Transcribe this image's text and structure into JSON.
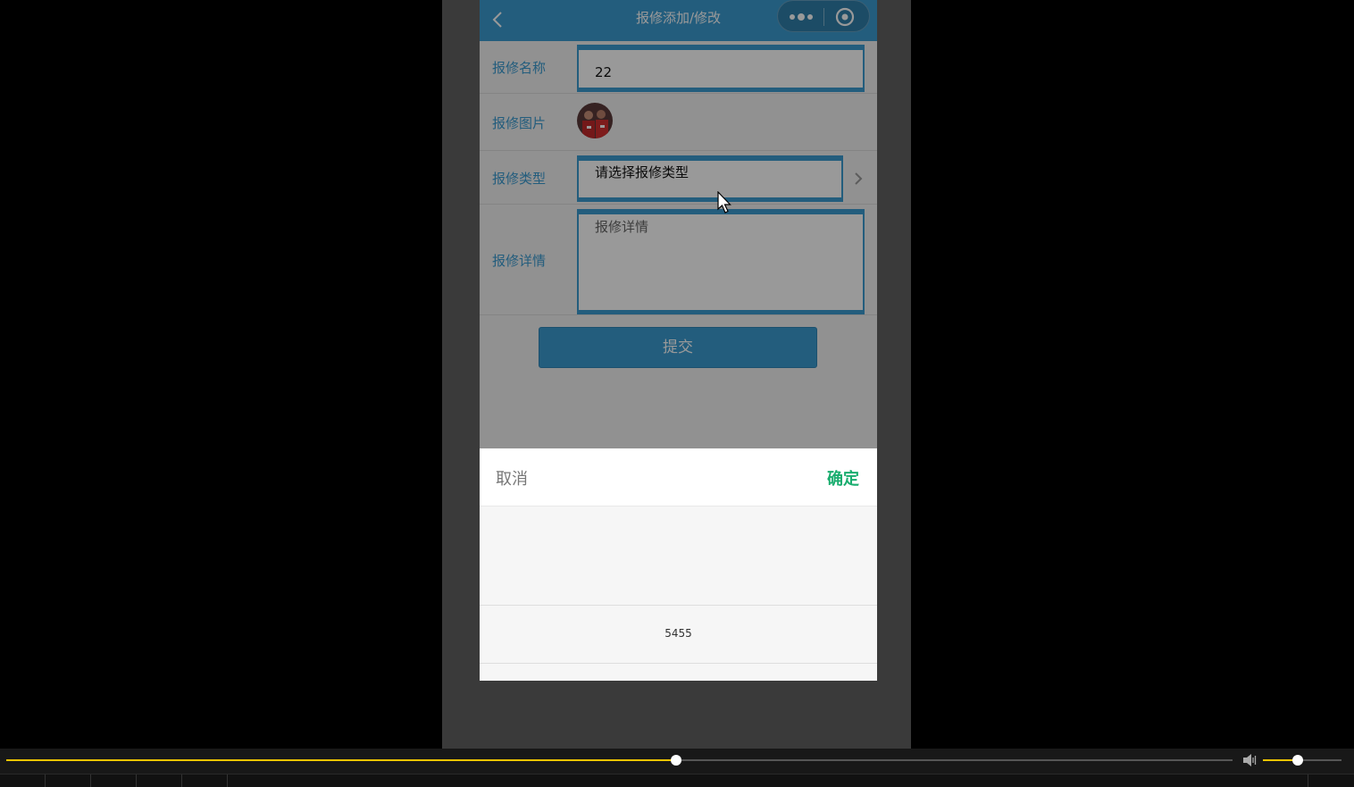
{
  "nav": {
    "title": "报修添加/修改",
    "back_icon": "chevron-left-icon",
    "more_icon": "more-dots-icon",
    "close_icon": "target-circle-icon"
  },
  "form": {
    "name": {
      "label": "报修名称",
      "value": "22"
    },
    "image": {
      "label": "报修图片"
    },
    "type": {
      "label": "报修类型",
      "value": "请选择报修类型"
    },
    "detail": {
      "label": "报修详情",
      "placeholder": "报修详情"
    },
    "submit_label": "提交"
  },
  "picker": {
    "cancel_label": "取消",
    "confirm_label": "确定",
    "selected_option": "5455"
  },
  "player": {
    "progress_fraction": 0.546,
    "volume_fraction": 0.44
  },
  "colors": {
    "accent": "#3b9bd1",
    "confirm": "#1aad6f",
    "progress": "#f0c400"
  }
}
